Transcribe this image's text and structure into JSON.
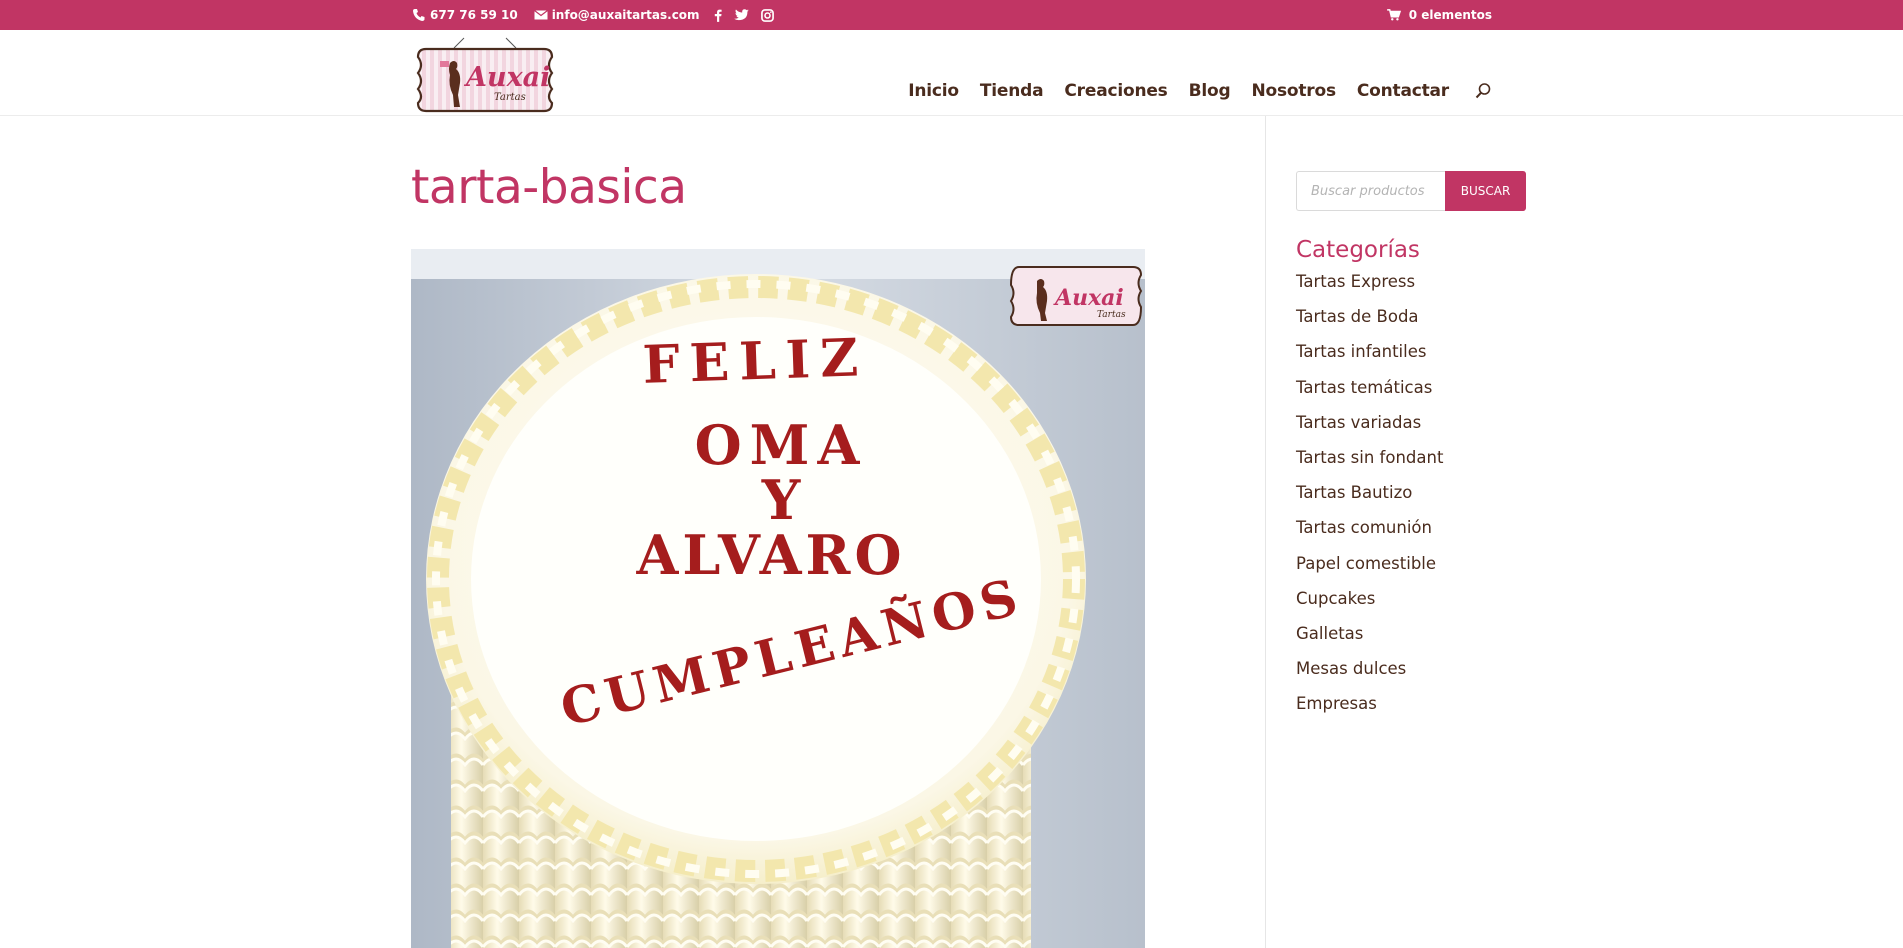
{
  "topbar": {
    "phone": "677 76 59 10",
    "email": "info@auxaitartas.com",
    "social": [
      "facebook-icon",
      "twitter-icon",
      "instagram-icon"
    ],
    "cart_label": "0 elementos",
    "color": "#c13564"
  },
  "logo": {
    "brand": "Auxai",
    "sub": "Tartas"
  },
  "nav": {
    "items": [
      "Inicio",
      "Tienda",
      "Creaciones",
      "Blog",
      "Nosotros",
      "Contactar"
    ]
  },
  "main": {
    "title": "tarta-basica",
    "cake": {
      "line1": "FELIZ",
      "line2": "OMA",
      "line3": "Y",
      "line4": "ALVARO",
      "line5": "CUMPLEAÑOS",
      "watermark_brand": "Auxai",
      "watermark_sub": "Tartas"
    }
  },
  "sidebar": {
    "search": {
      "placeholder": "Buscar productos",
      "button": "BUSCAR"
    },
    "categories_title": "Categorías",
    "categories": [
      "Tartas Express",
      "Tartas de Boda",
      "Tartas infantiles",
      "Tartas temáticas",
      "Tartas variadas",
      "Tartas sin fondant",
      "Tartas Bautizo",
      "Tartas comunión",
      "Papel comestible",
      "Cupcakes",
      "Galletas",
      "Mesas dulces",
      "Empresas"
    ]
  }
}
